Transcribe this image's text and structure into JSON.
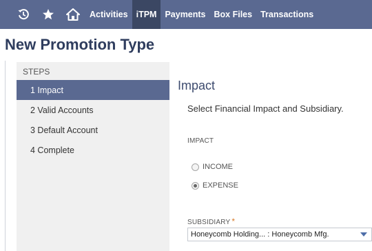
{
  "nav": {
    "icons": [
      "recent-icon",
      "star-icon",
      "home-icon"
    ],
    "items": [
      {
        "label": "Activities"
      },
      {
        "label": "iTPM"
      },
      {
        "label": "Payments"
      },
      {
        "label": "Box Files"
      },
      {
        "label": "Transactions"
      }
    ],
    "active": "iTPM"
  },
  "page": {
    "title": "New Promotion Type"
  },
  "steps": {
    "header": "STEPS",
    "items": [
      {
        "label": "1 Impact"
      },
      {
        "label": "2 Valid Accounts"
      },
      {
        "label": "3 Default Account"
      },
      {
        "label": "4 Complete"
      }
    ],
    "active": "1 Impact"
  },
  "main": {
    "section_title": "Impact",
    "intro": "Select Financial Impact and Subsidiary.",
    "impact_label": "IMPACT",
    "options": [
      {
        "label": "INCOME",
        "checked": false
      },
      {
        "label": "EXPENSE",
        "checked": true
      }
    ],
    "subsidiary_label": "SUBSIDIARY",
    "required_mark": "*",
    "subsidiary_value": "Honeycomb Holding... : Honeycomb Mfg."
  },
  "colors": {
    "nav_bg": "#5a6991",
    "nav_active": "#3b4763",
    "title": "#2f3d5e",
    "required": "#d77a2a"
  }
}
